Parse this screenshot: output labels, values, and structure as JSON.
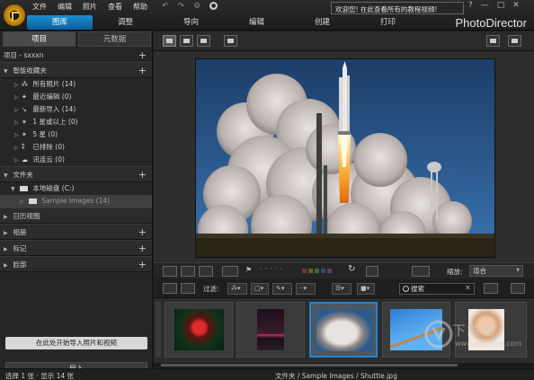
{
  "app": {
    "brand": "PhotoDirector",
    "notice": "欢迎您! 在此查看所有的教程视频!"
  },
  "menu": [
    "文件",
    "编辑",
    "照片",
    "查看",
    "帮助"
  ],
  "window_controls": [
    "?",
    "—",
    "□",
    "✕"
  ],
  "main_tabs": [
    {
      "label": "图库",
      "active": true
    },
    {
      "label": "调整",
      "active": false
    },
    {
      "label": "导向",
      "active": false
    },
    {
      "label": "编辑",
      "active": false
    },
    {
      "label": "创建",
      "active": false
    },
    {
      "label": "打印",
      "active": false
    }
  ],
  "left_panel": {
    "tabs": [
      {
        "label": "项目",
        "active": true
      },
      {
        "label": "元数据",
        "active": false
      }
    ],
    "project_label": "项目 - sxxxn",
    "smart_collections": {
      "title": "智能收藏夹",
      "items": [
        {
          "icon": "people-icon",
          "label": "所有照片 (14)"
        },
        {
          "icon": "recent-edit-icon",
          "label": "最近编辑 (0)"
        },
        {
          "icon": "import-icon",
          "label": "最新导入 (14)"
        },
        {
          "icon": "star-icon",
          "label": "1 星或以上 (0)"
        },
        {
          "icon": "star-icon",
          "label": "5 星 (0)"
        },
        {
          "icon": "reject-icon",
          "label": "已排除 (0)"
        },
        {
          "icon": "cloud-icon",
          "label": "讯连云 (0)"
        }
      ]
    },
    "folders": {
      "title": "文件夹",
      "drive": "本地磁盘 (C:)",
      "folder": "Sample Images (14)"
    },
    "sections": [
      "日历视图",
      "相册",
      "标记",
      "脸部"
    ],
    "import_hint": "在此处开始导入照片和视频",
    "import_button": "导入"
  },
  "viewer": {
    "zoom_label": "缩放:",
    "zoom_value": "适合",
    "color_labels": [
      "#6a3a3a",
      "#6a5a2a",
      "#3f6a3a",
      "#2f4f6a",
      "#5a3a6a"
    ]
  },
  "filter": {
    "label": "过滤:",
    "search_placeholder": "搜索"
  },
  "thumbnails": [
    {
      "name": "red-flower",
      "selected": false
    },
    {
      "name": "street-night",
      "selected": false
    },
    {
      "name": "rocket-launch",
      "selected": true
    },
    {
      "name": "skateboard-jump",
      "selected": false
    },
    {
      "name": "portrait-woman",
      "selected": false
    }
  ],
  "status": {
    "selection": "选择 1 张 · 显示 14 张",
    "path": "文件夹 / Sample Images / Shuttle.jpg"
  },
  "watermark": {
    "text": "下载吧",
    "url": "www.xiazaiba.com"
  }
}
